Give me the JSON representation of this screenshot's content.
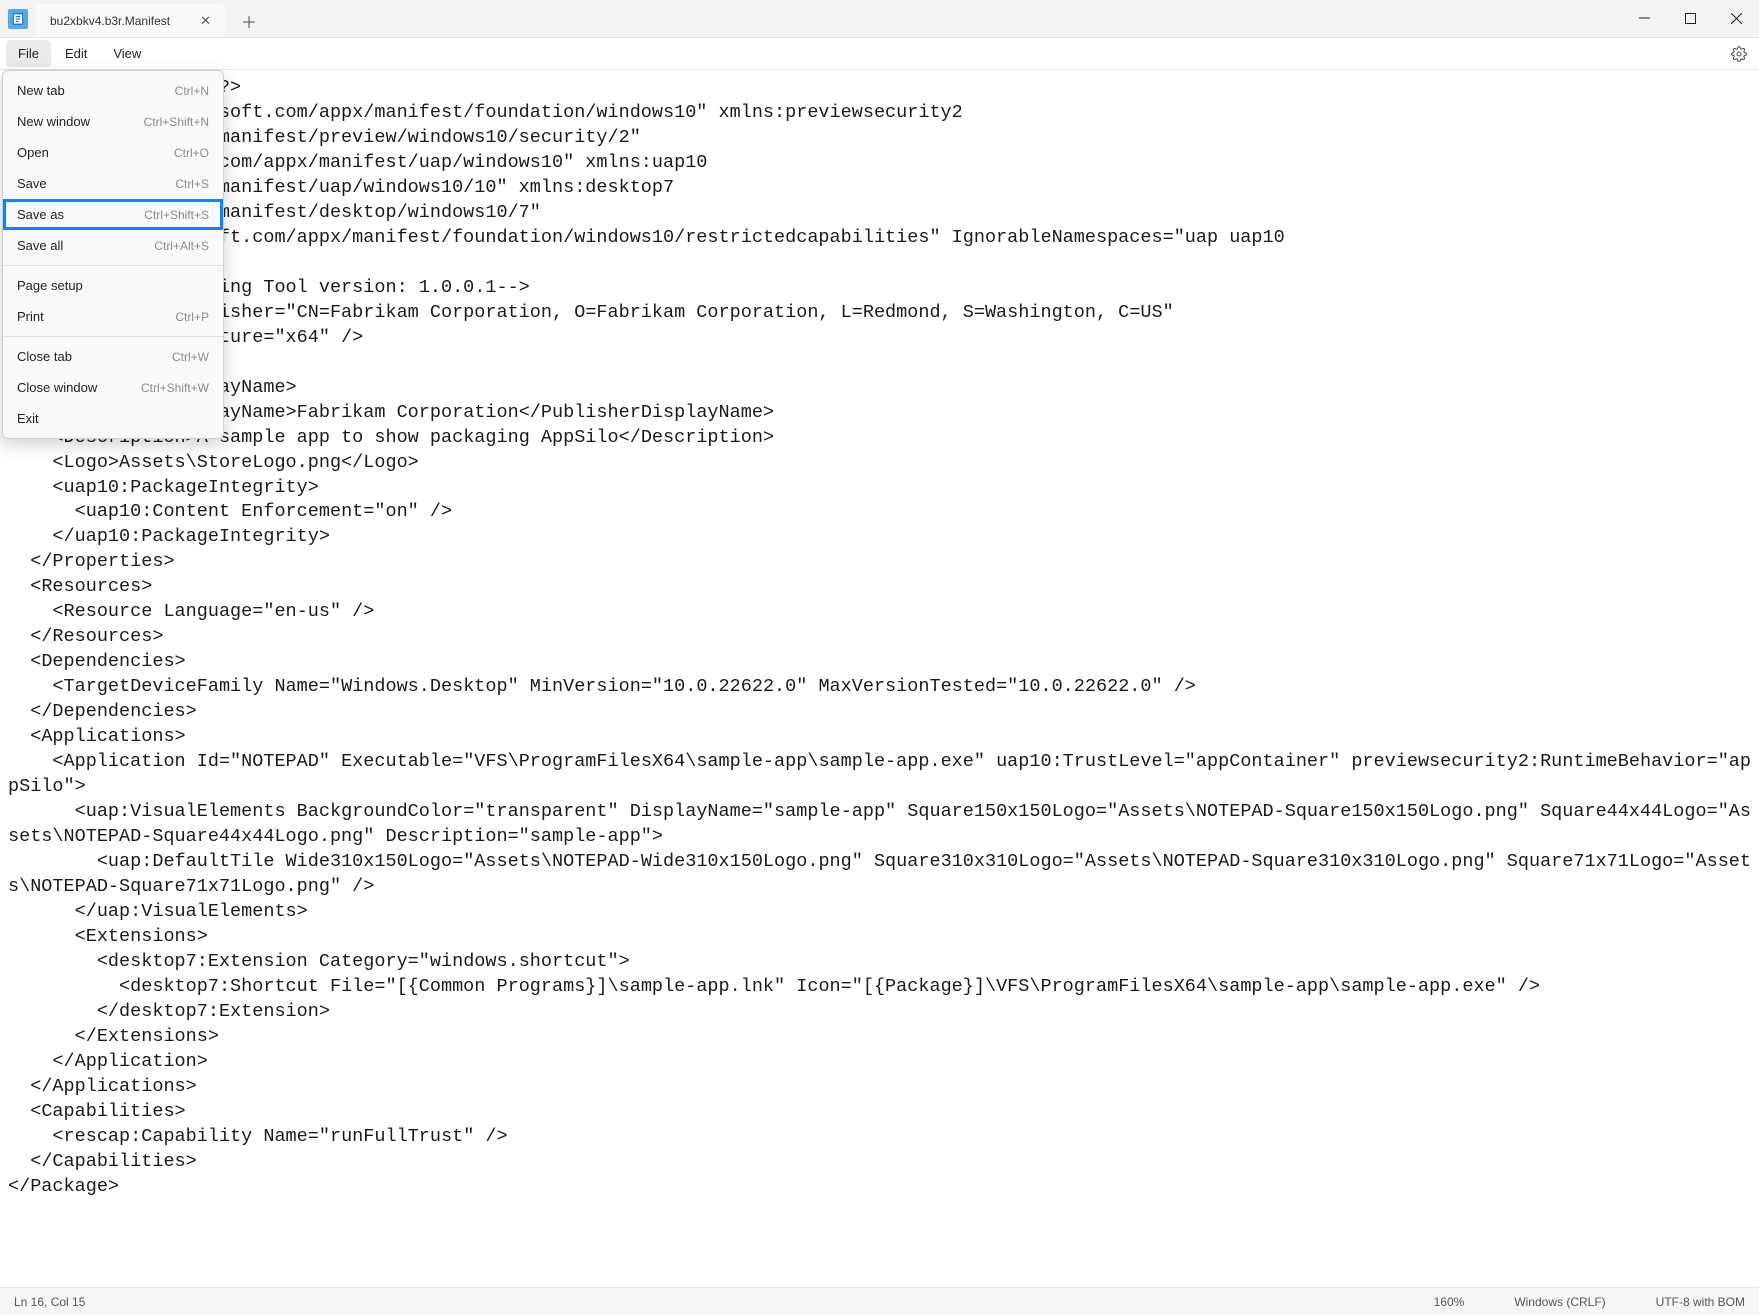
{
  "window": {
    "tab_title": "bu2xbkv4.b3r.Manifest"
  },
  "menu": {
    "file": "File",
    "edit": "Edit",
    "view": "View"
  },
  "file_menu": {
    "new_tab": {
      "label": "New tab",
      "shortcut": "Ctrl+N"
    },
    "new_window": {
      "label": "New window",
      "shortcut": "Ctrl+Shift+N"
    },
    "open": {
      "label": "Open",
      "shortcut": "Ctrl+O"
    },
    "save": {
      "label": "Save",
      "shortcut": "Ctrl+S"
    },
    "save_as": {
      "label": "Save as",
      "shortcut": "Ctrl+Shift+S"
    },
    "save_all": {
      "label": "Save all",
      "shortcut": "Ctrl+Alt+S"
    },
    "page_setup": {
      "label": "Page setup",
      "shortcut": ""
    },
    "print": {
      "label": "Print",
      "shortcut": "Ctrl+P"
    },
    "close_tab": {
      "label": "Close tab",
      "shortcut": "Ctrl+W"
    },
    "close_window": {
      "label": "Close window",
      "shortcut": "Ctrl+Shift+W"
    },
    "exit": {
      "label": "Exit",
      "shortcut": ""
    }
  },
  "editor_text": "0\" encoding=\"utf-8\"?>\nttp://schemas.microsoft.com/appx/manifest/foundation/windows10\" xmlns:previewsecurity2\nmicrosoft.com/appx/manifest/preview/windows10/security/2\"\n/schemas.microsoft.com/appx/manifest/uap/windows10\" xmlns:uap10\nmicrosoft.com/appx/manifest/uap/windows10/10\" xmlns:desktop7\nmicrosoft.com/appx/manifest/desktop/windows10/7\"\np://schemas.microsoft.com/appx/manifest/foundation/windows10/restrictedcapabilities\" IgnorableNamespaces=\"uap uap10\nreviewsecurity2\">\nated by MSIX Packaging Tool version: 1.0.0.1-->\n\"Test-AppSilo\" Publisher=\"CN=Fabrikam Corporation, O=Fabrikam Corporation, L=Redmond, S=Washington, C=US\"\n  ProcessorArchitecture=\"x64\" />\n\nTest AppSilo</DisplayName>\n    <PublisherDisplayName>Fabrikam Corporation</PublisherDisplayName>\n    <Description>A sample app to show packaging AppSilo</Description>\n    <Logo>Assets\\StoreLogo.png</Logo>\n    <uap10:PackageIntegrity>\n      <uap10:Content Enforcement=\"on\" />\n    </uap10:PackageIntegrity>\n  </Properties>\n  <Resources>\n    <Resource Language=\"en-us\" />\n  </Resources>\n  <Dependencies>\n    <TargetDeviceFamily Name=\"Windows.Desktop\" MinVersion=\"10.0.22622.0\" MaxVersionTested=\"10.0.22622.0\" />\n  </Dependencies>\n  <Applications>\n    <Application Id=\"NOTEPAD\" Executable=\"VFS\\ProgramFilesX64\\sample-app\\sample-app.exe\" uap10:TrustLevel=\"appContainer\" previewsecurity2:RuntimeBehavior=\"appSilo\">\n      <uap:VisualElements BackgroundColor=\"transparent\" DisplayName=\"sample-app\" Square150x150Logo=\"Assets\\NOTEPAD-Square150x150Logo.png\" Square44x44Logo=\"Assets\\NOTEPAD-Square44x44Logo.png\" Description=\"sample-app\">\n        <uap:DefaultTile Wide310x150Logo=\"Assets\\NOTEPAD-Wide310x150Logo.png\" Square310x310Logo=\"Assets\\NOTEPAD-Square310x310Logo.png\" Square71x71Logo=\"Assets\\NOTEPAD-Square71x71Logo.png\" />\n      </uap:VisualElements>\n      <Extensions>\n        <desktop7:Extension Category=\"windows.shortcut\">\n          <desktop7:Shortcut File=\"[{Common Programs}]\\sample-app.lnk\" Icon=\"[{Package}]\\VFS\\ProgramFilesX64\\sample-app\\sample-app.exe\" />\n        </desktop7:Extension>\n      </Extensions>\n    </Application>\n  </Applications>\n  <Capabilities>\n    <rescap:Capability Name=\"runFullTrust\" />\n  </Capabilities>\n</Package>",
  "status": {
    "position": "Ln 16, Col 15",
    "zoom": "160%",
    "line_ending": "Windows (CRLF)",
    "encoding": "UTF-8 with BOM"
  }
}
